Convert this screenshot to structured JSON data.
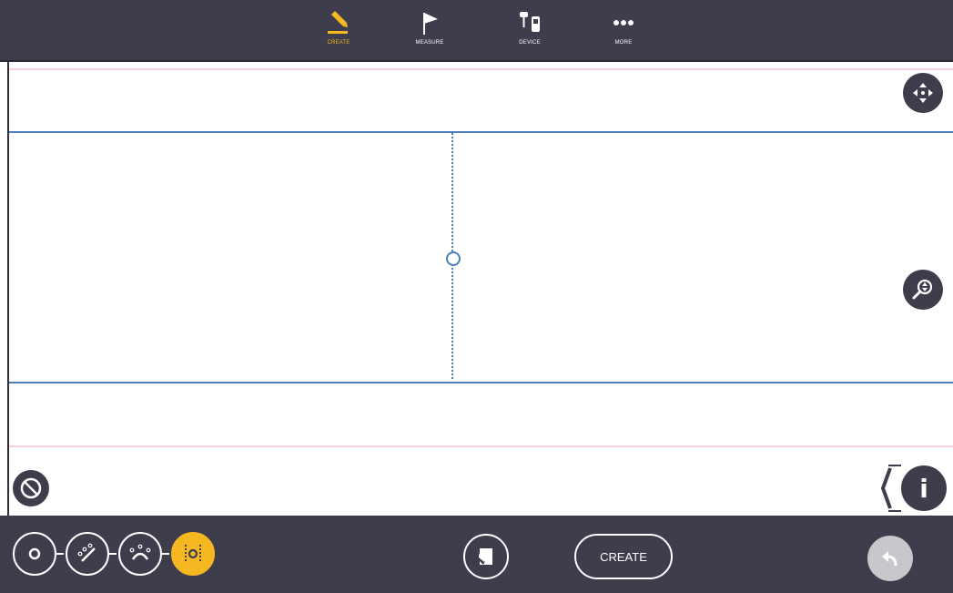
{
  "top_nav": {
    "tabs": [
      {
        "label": "CREATE",
        "icon": "pencil-icon",
        "active": true
      },
      {
        "label": "MEASURE",
        "icon": "flag-icon",
        "active": false
      },
      {
        "label": "DEVICE",
        "icon": "device-icon",
        "active": false
      },
      {
        "label": "MORE",
        "icon": "more-dots-icon",
        "active": false
      }
    ]
  },
  "canvas": {
    "controls": {
      "pan": "move-arrows-icon",
      "zoom": "zoom-icon",
      "cancel": "cancel-icon",
      "info_glyph": "i"
    }
  },
  "bottom_bar": {
    "modes": [
      {
        "icon": "point-mode-icon",
        "active": false
      },
      {
        "icon": "line-mode-icon",
        "active": false
      },
      {
        "icon": "arc-mode-icon",
        "active": false
      },
      {
        "icon": "offset-mode-icon",
        "active": true
      }
    ],
    "note_icon": "note-icon",
    "create_label": "CREATE",
    "undo_icon": "undo-icon"
  },
  "colors": {
    "bar": "#3d3d4c",
    "accent": "#f5b820",
    "line_blue": "#4a7fba",
    "line_pink": "#f6d4d8"
  }
}
